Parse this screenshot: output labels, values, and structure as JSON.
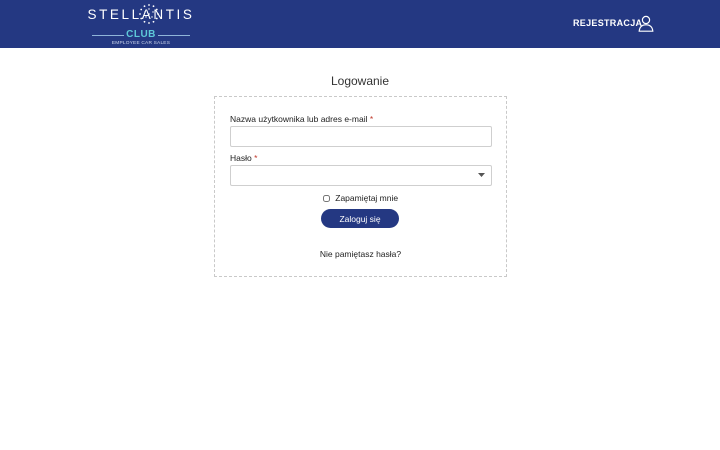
{
  "header": {
    "brand_wordmark": "STELLANTIS",
    "brand_club": "CLUB",
    "brand_sub": "EMPLOYEE CAR SALES",
    "register_label": "REJESTRACJA",
    "bg_color": "#243882",
    "user_icon": "user-icon"
  },
  "login": {
    "title": "Logowanie",
    "username_label": "Nazwa użytkownika lub adres e-mail",
    "username_value": "",
    "password_label": "Hasło",
    "password_value": "",
    "required_mark": "*",
    "remember_label": "Zapamiętaj mnie",
    "remember_checked": false,
    "submit_label": "Zaloguj się",
    "forgot_label": "Nie pamiętasz hasła?",
    "accent_color": "#243882"
  }
}
